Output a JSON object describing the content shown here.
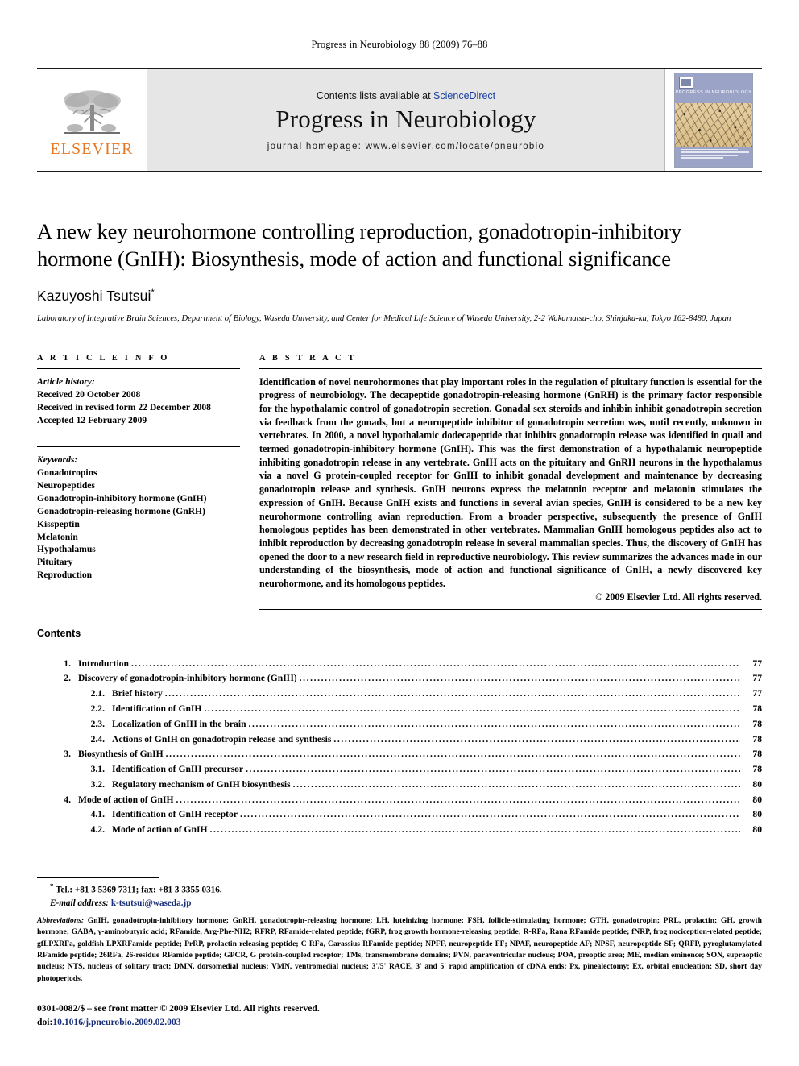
{
  "running_head": "Progress in Neurobiology 88 (2009) 76–88",
  "banner": {
    "publisher_name": "ELSEVIER",
    "contents_prefix": "Contents lists available at",
    "sciencedirect": "ScienceDirect",
    "journal_title": "Progress in Neurobiology",
    "homepage": "journal homepage: www.elsevier.com/locate/pneurobio",
    "cover_journal_name": "PROGRESS IN NEUROBIOLOGY"
  },
  "article": {
    "title": "A new key neurohormone controlling reproduction, gonadotropin-inhibitory hormone (GnIH): Biosynthesis, mode of action and functional significance",
    "author": "Kazuyoshi Tsutsui",
    "author_marker": "*",
    "affiliation": "Laboratory of Integrative Brain Sciences, Department of Biology, Waseda University, and Center for Medical Life Science of Waseda University, 2-2 Wakamatsu-cho, Shinjuku-ku, Tokyo 162-8480, Japan"
  },
  "article_info": {
    "heading": "A R T I C L E   I N F O",
    "history_label": "Article history:",
    "history": [
      "Received 20 October 2008",
      "Received in revised form 22 December 2008",
      "Accepted 12 February 2009"
    ],
    "keywords_label": "Keywords:",
    "keywords": [
      "Gonadotropins",
      "Neuropeptides",
      "Gonadotropin-inhibitory hormone (GnIH)",
      "Gonadotropin-releasing hormone (GnRH)",
      "Kisspeptin",
      "Melatonin",
      "Hypothalamus",
      "Pituitary",
      "Reproduction"
    ]
  },
  "abstract": {
    "heading": "A B S T R A C T",
    "body": "Identification of novel neurohormones that play important roles in the regulation of pituitary function is essential for the progress of neurobiology. The decapeptide gonadotropin-releasing hormone (GnRH) is the primary factor responsible for the hypothalamic control of gonadotropin secretion. Gonadal sex steroids and inhibin inhibit gonadotropin secretion via feedback from the gonads, but a neuropeptide inhibitor of gonadotropin secretion was, until recently, unknown in vertebrates. In 2000, a novel hypothalamic dodecapeptide that inhibits gonadotropin release was identified in quail and termed gonadotropin-inhibitory hormone (GnIH). This was the first demonstration of a hypothalamic neuropeptide inhibiting gonadotropin release in any vertebrate. GnIH acts on the pituitary and GnRH neurons in the hypothalamus via a novel G protein-coupled receptor for GnIH to inhibit gonadal development and maintenance by decreasing gonadotropin release and synthesis. GnIH neurons express the melatonin receptor and melatonin stimulates the expression of GnIH. Because GnIH exists and functions in several avian species, GnIH is considered to be a new key neurohormone controlling avian reproduction. From a broader perspective, subsequently the presence of GnIH homologous peptides has been demonstrated in other vertebrates. Mammalian GnIH homologous peptides also act to inhibit reproduction by decreasing gonadotropin release in several mammalian species. Thus, the discovery of GnIH has opened the door to a new research field in reproductive neurobiology. This review summarizes the advances made in our understanding of the biosynthesis, mode of action and functional significance of GnIH, a newly discovered key neurohormone, and its homologous peptides.",
    "copyright": "© 2009 Elsevier Ltd. All rights reserved."
  },
  "contents": {
    "heading": "Contents",
    "entries": [
      {
        "num": "1.",
        "level": 1,
        "label": "Introduction",
        "page": "77"
      },
      {
        "num": "2.",
        "level": 1,
        "label": "Discovery of gonadotropin-inhibitory hormone (GnIH)",
        "page": "77"
      },
      {
        "num": "2.1.",
        "level": 2,
        "label": "Brief history",
        "page": "77"
      },
      {
        "num": "2.2.",
        "level": 2,
        "label": "Identification of GnIH",
        "page": "78"
      },
      {
        "num": "2.3.",
        "level": 2,
        "label": "Localization of GnIH in the brain",
        "page": "78"
      },
      {
        "num": "2.4.",
        "level": 2,
        "label": "Actions of GnIH on gonadotropin release and synthesis",
        "page": "78"
      },
      {
        "num": "3.",
        "level": 1,
        "label": "Biosynthesis of GnIH",
        "page": "78"
      },
      {
        "num": "3.1.",
        "level": 2,
        "label": "Identification of GnIH precursor",
        "page": "78"
      },
      {
        "num": "3.2.",
        "level": 2,
        "label": "Regulatory mechanism of GnIH biosynthesis",
        "page": "80"
      },
      {
        "num": "4.",
        "level": 1,
        "label": "Mode of action of GnIH",
        "page": "80"
      },
      {
        "num": "4.1.",
        "level": 2,
        "label": "Identification of GnIH receptor",
        "page": "80"
      },
      {
        "num": "4.2.",
        "level": 2,
        "label": "Mode of action of GnIH",
        "page": "80"
      }
    ]
  },
  "footnotes": {
    "tel_fax": "Tel.: +81 3 5369 7311; fax: +81 3 3355 0316.",
    "email_label": "E-mail address:",
    "email": "k-tsutsui@waseda.jp",
    "abbreviations_label": "Abbreviations:",
    "abbreviations": "GnIH, gonadotropin-inhibitory hormone; GnRH, gonadotropin-releasing hormone; LH, luteinizing hormone; FSH, follicle-stimulating hormone; GTH, gonadotropin; PRL, prolactin; GH, growth hormone; GABA, γ-aminobutyric acid; RFamide, Arg-Phe-NH2; RFRP, RFamide-related peptide; fGRP, frog growth hormone-releasing peptide; R-RFa, Rana RFamide peptide; fNRP, frog nociception-related peptide; gfLPXRFa, goldfish LPXRFamide peptide; PrRP, prolactin-releasing peptide; C-RFa, Carassius RFamide peptide; NPFF, neuropeptide FF; NPAF, neuropeptide AF; NPSF, neuropeptide SF; QRFP, pyroglutamylated RFamide peptide; 26RFa, 26-residue RFamide peptide; GPCR, G protein-coupled receptor; TMs, transmembrane domains; PVN, paraventricular nucleus; POA, preoptic area; ME, median eminence; SON, supraoptic nucleus; NTS, nucleus of solitary tract; DMN, dorsomedial nucleus; VMN, ventromedial nucleus; 3'/5' RACE, 3' and 5' rapid amplification of cDNA ends; Px, pinealectomy; Ex, orbital enucleation; SD, short day photoperiods."
  },
  "imprint": {
    "line1": "0301-0082/$ – see front matter © 2009 Elsevier Ltd. All rights reserved.",
    "doi_label": "doi:",
    "doi": "10.1016/j.pneurobio.2009.02.003"
  }
}
